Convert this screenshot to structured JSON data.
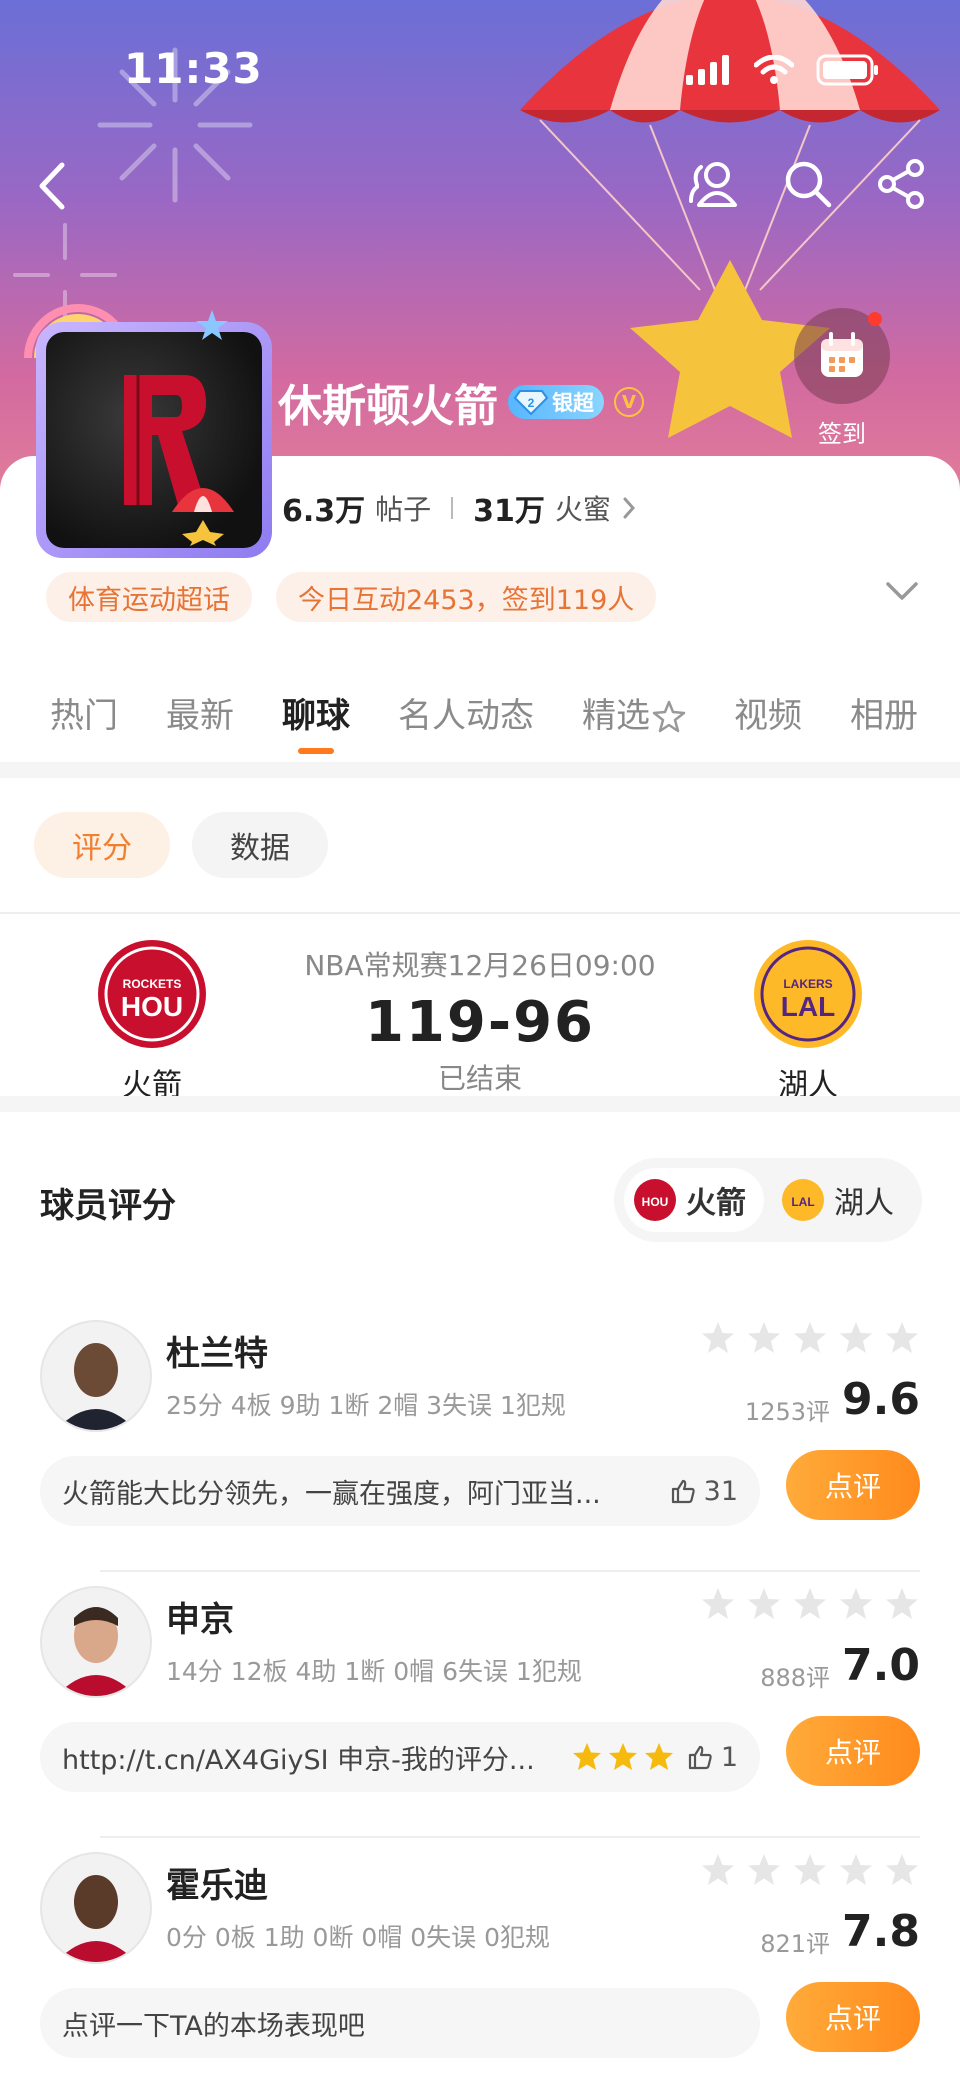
{
  "status_bar": {
    "time": "11:33"
  },
  "header": {
    "club_name": "休斯顿火箭",
    "level_badge": "2",
    "silver_badge": "银超",
    "verified_mark": "V",
    "checkin_label": "签到"
  },
  "stats": {
    "posts_value": "6.3万",
    "posts_label": "帖子",
    "fans_value": "31万",
    "fans_label": "火蜜"
  },
  "tags": [
    "体育运动超话",
    "今日互动2453，签到119人"
  ],
  "tabs": [
    "热门",
    "最新",
    "聊球",
    "名人动态",
    "精选",
    "视频",
    "相册"
  ],
  "sub_tabs": [
    "评分",
    "数据"
  ],
  "game": {
    "league_time": "NBA常规赛12月26日09:00",
    "score": "119-96",
    "status": "已结束",
    "home": {
      "name": "火箭",
      "abbr": "HOU",
      "sub": "ROCKETS",
      "color": "#c8102e"
    },
    "away": {
      "name": "湖人",
      "abbr": "LAL",
      "sub": "LAKERS",
      "color": "#552583",
      "bg": "#fdb927"
    }
  },
  "ratings": {
    "title": "球员评分",
    "switch": [
      "火箭",
      "湖人"
    ],
    "players": [
      {
        "name": "杜兰特",
        "stats": "25分 4板 9助 1断 2帽 3失误 1犯规",
        "count": "1253评",
        "score": "9.6",
        "comment": "火箭能大比分领先，一赢在强度，阿门亚当...",
        "likes": "31",
        "button": "点评"
      },
      {
        "name": "申京",
        "stats": "14分 12板 4助 1断 0帽 6失误 1犯规",
        "count": "888评",
        "score": "7.0",
        "comment": "http://t.cn/AX4GiySI 申京-我的评分...",
        "likes": "1",
        "button": "点评"
      },
      {
        "name": "霍乐迪",
        "stats": "0分 0板 1助 0断 0帽 0失误 0犯规",
        "count": "821评",
        "score": "7.8",
        "comment": "点评一下TA的本场表现吧",
        "likes": "",
        "button": "点评"
      }
    ]
  },
  "colors": {
    "accent": "#ff7a1c",
    "tag_text": "#e77334"
  }
}
